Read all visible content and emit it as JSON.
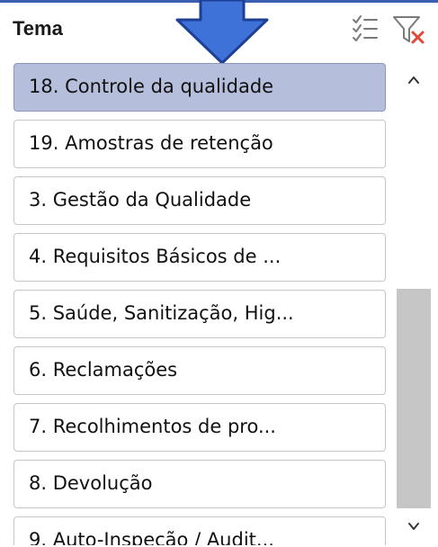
{
  "slicer": {
    "title": "Tema",
    "header_icons": {
      "multiselect": "multi-select-icon",
      "clear_filter": "clear-filter-icon"
    },
    "overlay": "down-arrow-icon",
    "colors": {
      "selected_fill": "#b5bedb",
      "item_border": "#c6c6c6",
      "arrow_fill": "#3f72d8",
      "arrow_stroke": "#1e3f96",
      "clear_x": "#e0493a"
    },
    "items": [
      {
        "label": "18. Controle da qualidade",
        "selected": true
      },
      {
        "label": "19. Amostras de retenção",
        "selected": false
      },
      {
        "label": "3. Gestão da Qualidade",
        "selected": false
      },
      {
        "label": "4. Requisitos Básicos de ...",
        "selected": false
      },
      {
        "label": "5. Saúde, Sanitização, Hig...",
        "selected": false
      },
      {
        "label": "6. Reclamações",
        "selected": false
      },
      {
        "label": "7. Recolhimentos de pro...",
        "selected": false
      },
      {
        "label": "8. Devolução",
        "selected": false
      },
      {
        "label": "9. Auto-Inspeção / Audit...",
        "selected": false
      }
    ]
  }
}
